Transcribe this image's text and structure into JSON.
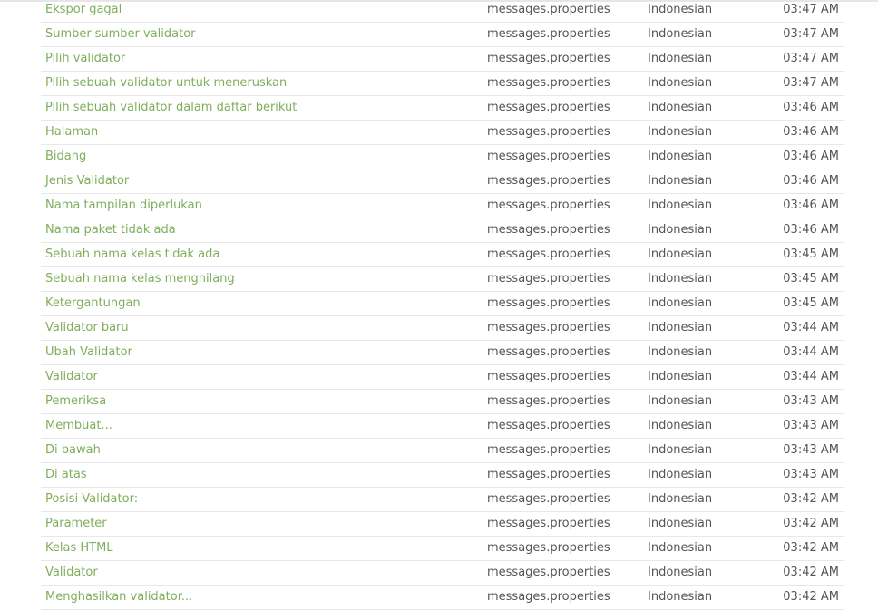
{
  "rows": [
    {
      "text": "Ekspor gagal",
      "file": "messages.properties",
      "language": "Indonesian",
      "time": "03:47 AM"
    },
    {
      "text": "Sumber-sumber validator",
      "file": "messages.properties",
      "language": "Indonesian",
      "time": "03:47 AM"
    },
    {
      "text": "Pilih validator",
      "file": "messages.properties",
      "language": "Indonesian",
      "time": "03:47 AM"
    },
    {
      "text": "Pilih sebuah validator untuk meneruskan",
      "file": "messages.properties",
      "language": "Indonesian",
      "time": "03:47 AM"
    },
    {
      "text": "Pilih sebuah validator dalam daftar berikut",
      "file": "messages.properties",
      "language": "Indonesian",
      "time": "03:46 AM"
    },
    {
      "text": "Halaman",
      "file": "messages.properties",
      "language": "Indonesian",
      "time": "03:46 AM"
    },
    {
      "text": "Bidang",
      "file": "messages.properties",
      "language": "Indonesian",
      "time": "03:46 AM"
    },
    {
      "text": "Jenis Validator",
      "file": "messages.properties",
      "language": "Indonesian",
      "time": "03:46 AM"
    },
    {
      "text": "Nama tampilan diperlukan",
      "file": "messages.properties",
      "language": "Indonesian",
      "time": "03:46 AM"
    },
    {
      "text": "Nama paket tidak ada",
      "file": "messages.properties",
      "language": "Indonesian",
      "time": "03:46 AM"
    },
    {
      "text": "Sebuah nama kelas tidak ada",
      "file": "messages.properties",
      "language": "Indonesian",
      "time": "03:45 AM"
    },
    {
      "text": "Sebuah nama kelas menghilang",
      "file": "messages.properties",
      "language": "Indonesian",
      "time": "03:45 AM"
    },
    {
      "text": "Ketergantungan",
      "file": "messages.properties",
      "language": "Indonesian",
      "time": "03:45 AM"
    },
    {
      "text": "Validator baru",
      "file": "messages.properties",
      "language": "Indonesian",
      "time": "03:44 AM"
    },
    {
      "text": "Ubah Validator",
      "file": "messages.properties",
      "language": "Indonesian",
      "time": "03:44 AM"
    },
    {
      "text": "Validator",
      "file": "messages.properties",
      "language": "Indonesian",
      "time": "03:44 AM"
    },
    {
      "text": "Pemeriksa",
      "file": "messages.properties",
      "language": "Indonesian",
      "time": "03:43 AM"
    },
    {
      "text": "Membuat...",
      "file": "messages.properties",
      "language": "Indonesian",
      "time": "03:43 AM"
    },
    {
      "text": "Di bawah",
      "file": "messages.properties",
      "language": "Indonesian",
      "time": "03:43 AM"
    },
    {
      "text": "Di atas",
      "file": "messages.properties",
      "language": "Indonesian",
      "time": "03:43 AM"
    },
    {
      "text": "Posisi Validator:",
      "file": "messages.properties",
      "language": "Indonesian",
      "time": "03:42 AM"
    },
    {
      "text": "Parameter",
      "file": "messages.properties",
      "language": "Indonesian",
      "time": "03:42 AM"
    },
    {
      "text": "Kelas HTML",
      "file": "messages.properties",
      "language": "Indonesian",
      "time": "03:42 AM"
    },
    {
      "text": "Validator",
      "file": "messages.properties",
      "language": "Indonesian",
      "time": "03:42 AM"
    },
    {
      "text": "Menghasilkan validator...",
      "file": "messages.properties",
      "language": "Indonesian",
      "time": "03:42 AM"
    }
  ]
}
